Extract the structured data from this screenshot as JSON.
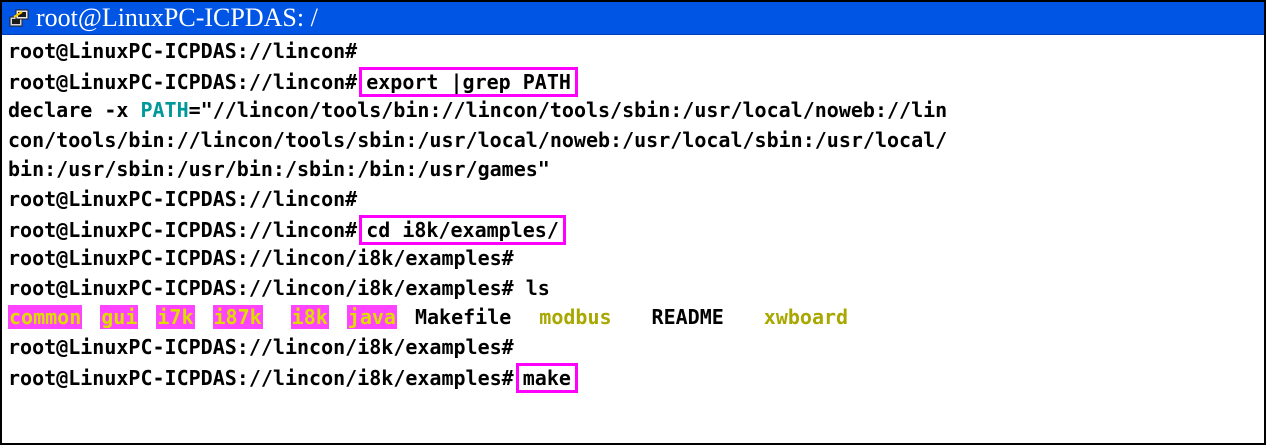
{
  "window": {
    "title": "root@LinuxPC-ICPDAS: /",
    "title_icon": "putty-terminal-icon",
    "colors": {
      "titlebar": "#0055e5",
      "highlight_border": "#ff00ff",
      "directory_bg": "#ff44ff",
      "directory_fg": "#dddd00",
      "env_var": "#009999",
      "file_yellow": "#a8a800"
    }
  },
  "terminal": {
    "lines": {
      "l1": "root@LinuxPC-ICPDAS://lincon#",
      "l2_prompt": "root@LinuxPC-ICPDAS://lincon#",
      "l2_cmd": "export |grep PATH",
      "l3_pre": "declare -x ",
      "l3_var": "PATH",
      "l3_post": "=\"//lincon/tools/bin://lincon/tools/sbin:/usr/local/noweb://lin",
      "l4": "con/tools/bin://lincon/tools/sbin:/usr/local/noweb:/usr/local/sbin:/usr/local/",
      "l5": "bin:/usr/sbin:/usr/bin:/sbin:/bin:/usr/games\"",
      "l6": "root@LinuxPC-ICPDAS://lincon#",
      "l7_prompt": "root@LinuxPC-ICPDAS://lincon#",
      "l7_cmd": "cd i8k/examples/",
      "l8": "root@LinuxPC-ICPDAS://lincon/i8k/examples#",
      "l9": "root@LinuxPC-ICPDAS://lincon/i8k/examples# ls",
      "l11": "root@LinuxPC-ICPDAS://lincon/i8k/examples#",
      "l12_prompt": "root@LinuxPC-ICPDAS://lincon/i8k/examples#",
      "l12_cmd": "make"
    },
    "listing": {
      "dirs": [
        "common",
        "gui",
        "i7k",
        "i87k",
        "i8k",
        "java"
      ],
      "makefile": "Makefile",
      "modbus": "modbus",
      "readme": "README",
      "xwboard": "xwboard"
    }
  }
}
